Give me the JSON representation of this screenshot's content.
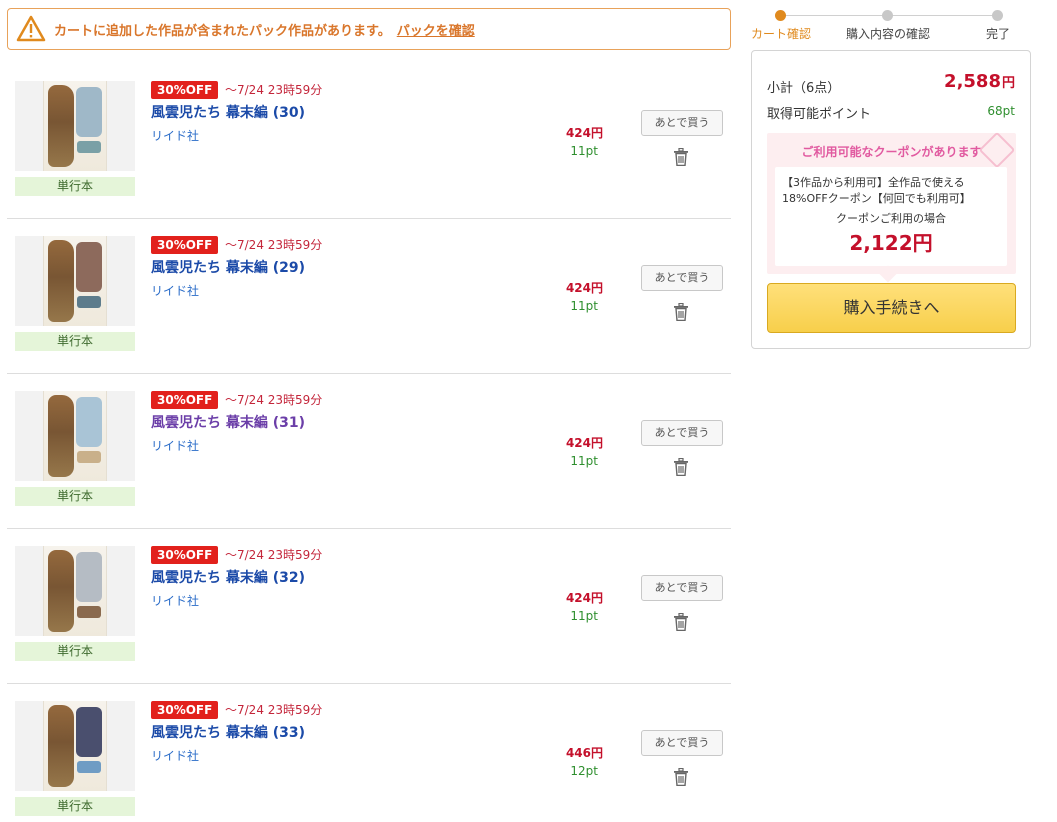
{
  "notice": {
    "message": "カートに追加した作品が含まれたパック作品があります。",
    "link": "パックを確認"
  },
  "steps": [
    {
      "label": "カート確認",
      "active": true
    },
    {
      "label": "購入内容の確認",
      "active": false
    },
    {
      "label": "完了",
      "active": false
    }
  ],
  "items": [
    {
      "badge": "30%OFF",
      "deadline": "～7/24 23時59分",
      "title": "風雲児たち 幕末編 (30)",
      "publisher": "リイド社",
      "price": "424円",
      "points": "11pt",
      "format": "単行本",
      "later": "あとで買う",
      "visited": false
    },
    {
      "badge": "30%OFF",
      "deadline": "～7/24 23時59分",
      "title": "風雲児たち 幕末編 (29)",
      "publisher": "リイド社",
      "price": "424円",
      "points": "11pt",
      "format": "単行本",
      "later": "あとで買う",
      "visited": false
    },
    {
      "badge": "30%OFF",
      "deadline": "～7/24 23時59分",
      "title": "風雲児たち 幕末編 (31)",
      "publisher": "リイド社",
      "price": "424円",
      "points": "11pt",
      "format": "単行本",
      "later": "あとで買う",
      "visited": true
    },
    {
      "badge": "30%OFF",
      "deadline": "～7/24 23時59分",
      "title": "風雲児たち 幕末編 (32)",
      "publisher": "リイド社",
      "price": "424円",
      "points": "11pt",
      "format": "単行本",
      "later": "あとで買う",
      "visited": false
    },
    {
      "badge": "30%OFF",
      "deadline": "～7/24 23時59分",
      "title": "風雲児たち 幕末編 (33)",
      "publisher": "リイド社",
      "price": "446円",
      "points": "12pt",
      "format": "単行本",
      "later": "あとで買う",
      "visited": false
    }
  ],
  "summary": {
    "subtotal_label": "小計（6点）",
    "subtotal_value": "2,588",
    "subtotal_unit": "円",
    "points_label": "取得可能ポイント",
    "points_value": "68pt"
  },
  "coupon": {
    "heading": "ご利用可能なクーポンがあります",
    "description": "【3作品から利用可】全作品で使える18%OFFクーポン【何回でも利用可】",
    "condition": "クーポンご利用の場合",
    "price": "2,122円"
  },
  "checkout_label": "購入手続きへ",
  "colors": {
    "accent_orange": "#e08a1e",
    "price_red": "#c4102b",
    "discount_red": "#e2211c",
    "points_green": "#2f8f2f",
    "link_blue": "#1b4aa8",
    "checkout_yellow": "#f7cf4b"
  }
}
